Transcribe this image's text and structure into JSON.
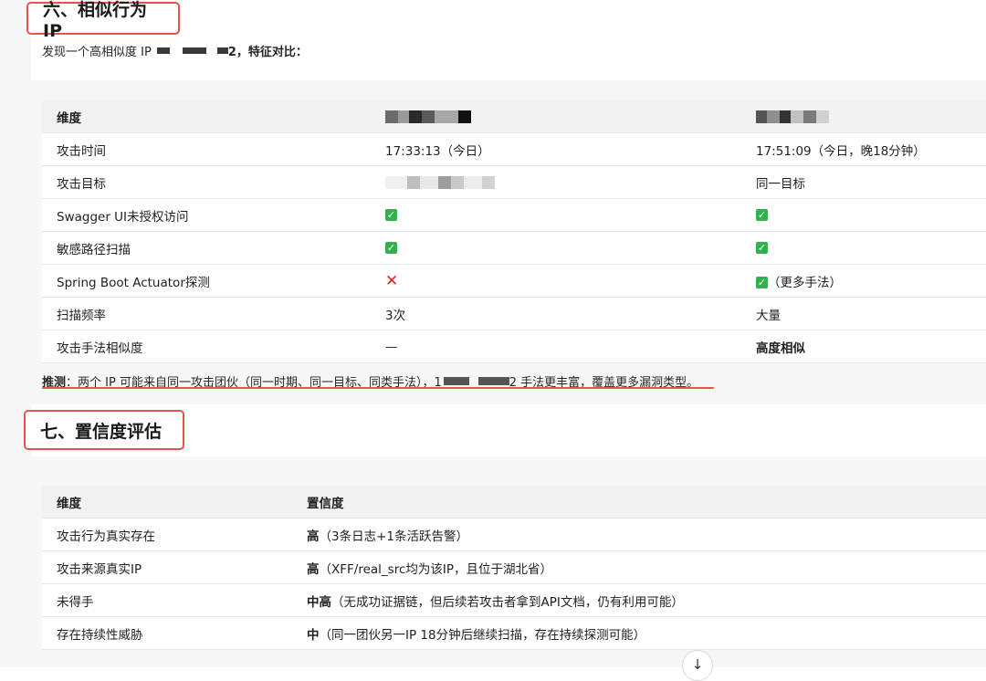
{
  "section6": {
    "heading": "六、相似行为 IP",
    "intro_prefix": "发现一个高相似度 IP",
    "intro_suffix": "2，特征对比："
  },
  "table1": {
    "header": "维度",
    "rows": [
      {
        "label": "攻击时间",
        "a": "17:33:13（今日）",
        "b": "17:51:09（今日，晚18分钟）"
      },
      {
        "label": "攻击目标",
        "a": "",
        "b": "同一目标"
      },
      {
        "label": "Swagger UI未授权访问",
        "a": "✅",
        "b": "✅"
      },
      {
        "label": "敏感路径扫描",
        "a": "✅",
        "b": "✅"
      },
      {
        "label": "Spring Boot Actuator探测",
        "a": "❌",
        "b": "✅（更多手法）"
      },
      {
        "label": "扫描频率",
        "a": "3次",
        "b": "大量"
      },
      {
        "label": "攻击手法相似度",
        "a": "—",
        "b": "高度相似"
      }
    ]
  },
  "note": {
    "label": "推测",
    "text1": "：两个 IP 可能来自同一攻击团伙（同一时期、同一目标、同类手法），1",
    "text2": "2 手法更丰富，覆盖更多漏洞类型。"
  },
  "section7": {
    "heading": "七、置信度评估",
    "headers": [
      "维度",
      "置信度"
    ],
    "rows": [
      {
        "label": "攻击行为真实存在",
        "level": "高",
        "detail": "（3条日志+1条活跃告警）"
      },
      {
        "label": "攻击来源真实IP",
        "level": "高",
        "detail": "（XFF/real_src均为该IP，且位于湖北省）"
      },
      {
        "label": "未得手",
        "level": "中高",
        "detail": "（无成功证据链，但后续若攻击者拿到API文档，仍有利用可能）"
      },
      {
        "label": "存在持续性威胁",
        "level": "中",
        "detail": "（同一团伙另一IP 18分钟后继续扫描，存在持续探测可能）"
      }
    ]
  },
  "icons": {
    "scroll": "arrow-down-icon",
    "check": "check-icon",
    "cross": "cross-icon"
  },
  "colors": {
    "highlight": "#e5534b",
    "check": "#31b24a",
    "cross": "#e02020"
  }
}
